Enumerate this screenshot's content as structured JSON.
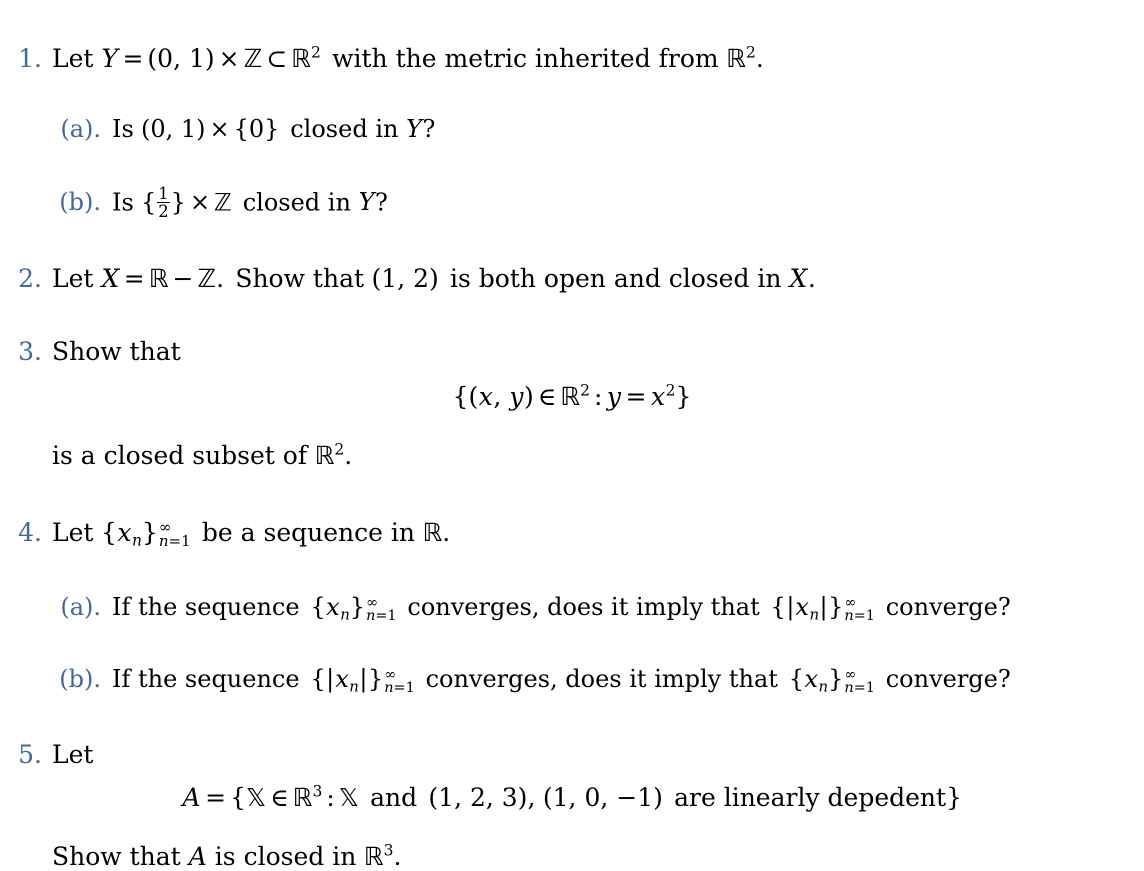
{
  "document": {
    "type": "math-problem-set",
    "accent_color": "#41699c",
    "text_color": "#000000",
    "background_color": "#ffffff"
  },
  "items": [
    {
      "marker": "1.",
      "text_plain": "Let Y = (0, 1) × ℤ ⊂ ℝ² with the metric inherited from ℝ².",
      "parts": {
        "lead": "Let",
        "var_Y": "Y",
        "eq": "=",
        "interval": "(0, 1)",
        "times": "×",
        "integers": "ℤ",
        "subset": "⊂",
        "reals": "ℝ",
        "exp2": "2",
        "tail": "with the metric inherited from",
        "reals2": "ℝ",
        "exp2b": "2",
        "period": "."
      },
      "subitems": [
        {
          "marker": "(a).",
          "text_plain": "Is (0, 1) × {0} closed in Y?",
          "parts": {
            "lead": "Is",
            "interval": "(0, 1)",
            "times": "×",
            "setzero": "{0}",
            "mid": "closed in",
            "var_Y": "Y",
            "q": "?"
          }
        },
        {
          "marker": "(b).",
          "text_plain": "Is {1/2} × ℤ closed in Y?",
          "parts": {
            "lead": "Is",
            "brace_open": "{",
            "frac_num": "1",
            "frac_den": "2",
            "brace_close": "}",
            "times": "×",
            "integers": "ℤ",
            "mid": "closed in",
            "var_Y": "Y",
            "q": "?"
          }
        }
      ]
    },
    {
      "marker": "2.",
      "text_plain": "Let X = ℝ − ℤ. Show that (1, 2) is both open and closed in X.",
      "parts": {
        "lead": "Let",
        "var_X": "X",
        "eq": "=",
        "reals": "ℝ",
        "minus": "−",
        "integers": "ℤ",
        "dot": ".",
        "mid": "Show that",
        "interval": "(1, 2)",
        "tail": "is both open and closed in",
        "var_X2": "X",
        "period": "."
      }
    },
    {
      "marker": "3.",
      "text_plain": "Show that",
      "parts": {
        "lead": "Show that"
      },
      "display": {
        "text_plain": "{(x, y) ∈ ℝ² : y = x²}",
        "parts": {
          "brace_open": "{",
          "paren_open": "(",
          "var_x": "x",
          "comma": ",",
          "var_y": "y",
          "paren_close": ")",
          "in": "∈",
          "reals": "ℝ",
          "exp2": "2",
          "colon": ":",
          "var_y2": "y",
          "eq": "=",
          "var_x2": "x",
          "exp2b": "2",
          "brace_close": "}"
        }
      },
      "after": {
        "text_plain": "is a closed subset of ℝ².",
        "parts": {
          "lead": "is a closed subset of",
          "reals": "ℝ",
          "exp2": "2",
          "period": "."
        }
      }
    },
    {
      "marker": "4.",
      "text_plain": "Let {xₙ}∞ₙ₌₁ be a sequence in ℝ.",
      "parts": {
        "lead": "Let",
        "brace_open": "{",
        "var_x": "x",
        "sub_n": "n",
        "brace_close": "}",
        "limit_top": "∞",
        "limit_bot_n": "n",
        "limit_bot_eq": "=1",
        "tail": "be a sequence in",
        "reals": "ℝ",
        "period": "."
      },
      "subitems": [
        {
          "marker": "(a).",
          "text_plain": "If the sequence {xₙ}∞ₙ₌₁ converges, does it imply that {|xₙ|}∞ₙ₌₁ converge?",
          "parts": {
            "lead": "If the sequence",
            "seq1_brace_open": "{",
            "seq1_var": "x",
            "seq1_sub": "n",
            "seq1_brace_close": "}",
            "seq1_top": "∞",
            "seq1_bot_n": "n",
            "seq1_bot_eq": "=1",
            "mid": "converges, does it imply that",
            "seq2_brace_open": "{",
            "seq2_bar_open": "|",
            "seq2_var": "x",
            "seq2_sub": "n",
            "seq2_bar_close": "|",
            "seq2_brace_close": "}",
            "seq2_top": "∞",
            "seq2_bot_n": "n",
            "seq2_bot_eq": "=1",
            "tail": "converge?"
          }
        },
        {
          "marker": "(b).",
          "text_plain": "If the sequence {|xₙ|}∞ₙ₌₁ converges, does it imply that {xₙ}∞ₙ₌₁ converge?",
          "parts": {
            "lead": "If the sequence",
            "seq1_brace_open": "{",
            "seq1_bar_open": "|",
            "seq1_var": "x",
            "seq1_sub": "n",
            "seq1_bar_close": "|",
            "seq1_brace_close": "}",
            "seq1_top": "∞",
            "seq1_bot_n": "n",
            "seq1_bot_eq": "=1",
            "mid": "converges, does it imply that",
            "seq2_brace_open": "{",
            "seq2_var": "x",
            "seq2_sub": "n",
            "seq2_brace_close": "}",
            "seq2_top": "∞",
            "seq2_bot_n": "n",
            "seq2_bot_eq": "=1",
            "tail": "converge?"
          }
        }
      ]
    },
    {
      "marker": "5.",
      "text_plain": "Let",
      "parts": {
        "lead": "Let"
      },
      "display": {
        "text_plain": "A = {𝕏 ∈ ℝ³ : 𝕏 and (1, 2, 3), (1, 0, −1) are linearly depedent}",
        "parts": {
          "var_A": "A",
          "eq": "=",
          "brace_open": "{",
          "bbX": "𝕏",
          "in": "∈",
          "reals": "ℝ",
          "exp3": "3",
          "colon": ":",
          "bbX2": "𝕏",
          "and": "and",
          "vec1": "(1, 2, 3)",
          "comma": ",",
          "vec2": "(1, 0, −1)",
          "tail": "are linearly depedent",
          "brace_close": "}"
        }
      },
      "after": {
        "text_plain": "Show that A is closed in ℝ³.",
        "parts": {
          "lead": "Show that",
          "var_A": "A",
          "mid": "is closed in",
          "reals": "ℝ",
          "exp3": "3",
          "period": "."
        }
      }
    }
  ]
}
